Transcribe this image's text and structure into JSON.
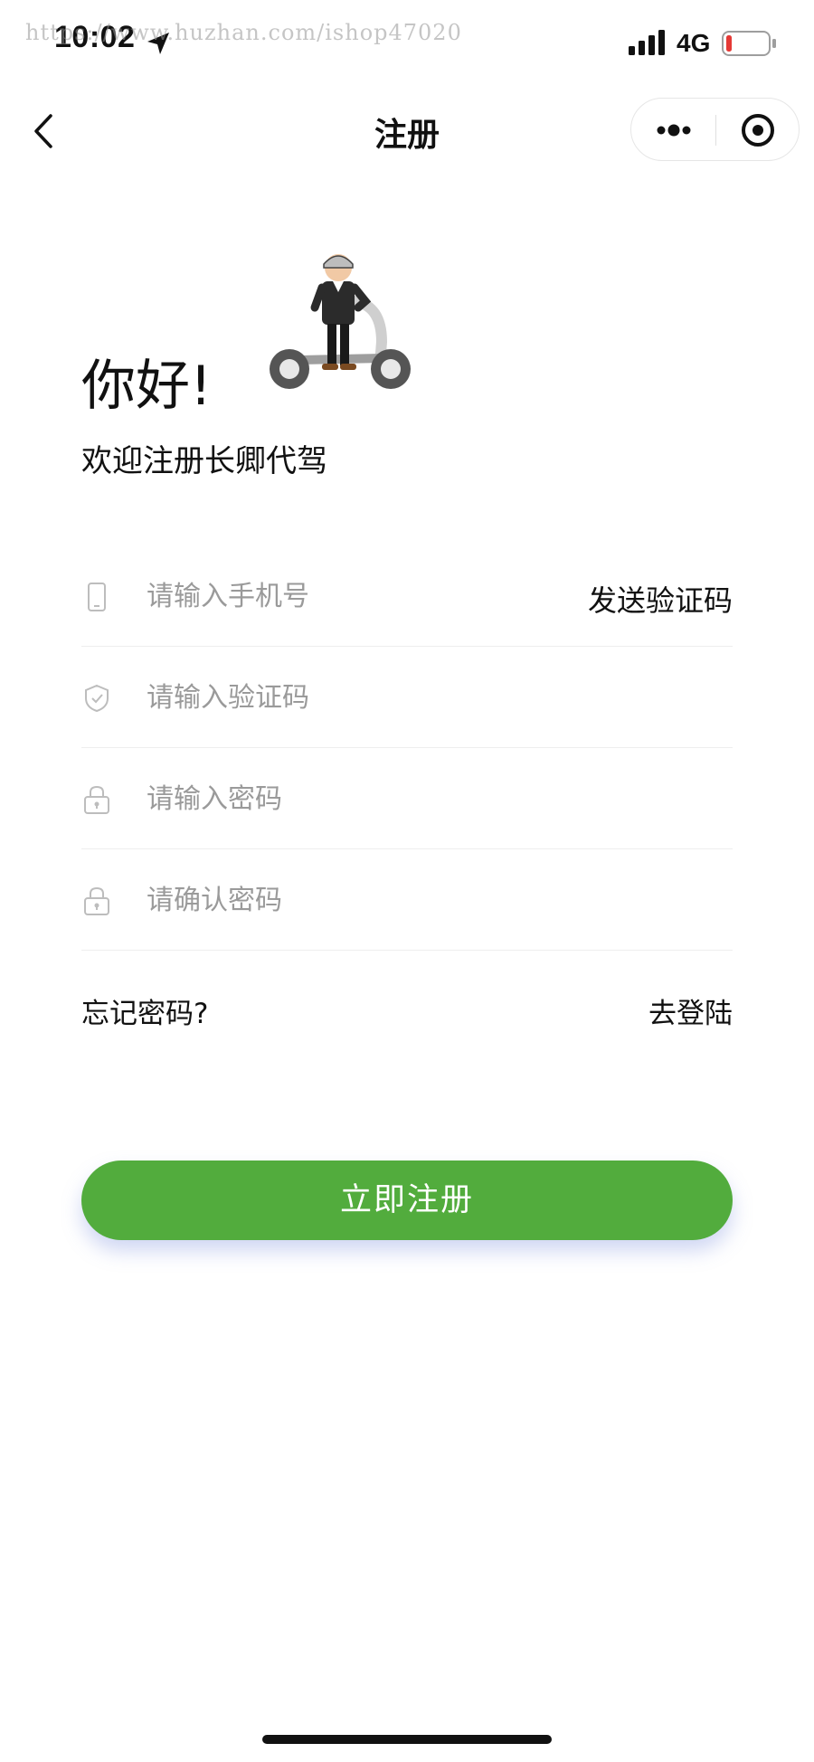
{
  "status_bar": {
    "time": "10:02",
    "network": "4G",
    "watermark": "https://www.huzhan.com/ishop47020",
    "battery_color": "#e53935"
  },
  "nav": {
    "title": "注册",
    "back_icon": "chevron-left-icon",
    "more_icon": "more-dots-icon",
    "close_icon": "target-circle-icon"
  },
  "hero": {
    "greeting": "你好!",
    "welcome": "欢迎注册长卿代驾",
    "mascot": "driver-on-scooter"
  },
  "form": {
    "phone": {
      "placeholder": "请输入手机号",
      "icon": "phone-icon",
      "value": ""
    },
    "send_code": "发送验证码",
    "code": {
      "placeholder": "请输入验证码",
      "icon": "shield-icon",
      "value": ""
    },
    "password": {
      "placeholder": "请输入密码",
      "icon": "lock-icon",
      "value": ""
    },
    "confirm_password": {
      "placeholder": "请确认密码",
      "icon": "lock-icon",
      "value": ""
    }
  },
  "links": {
    "forgot": "忘记密码?",
    "login": "去登陆"
  },
  "actions": {
    "register": "立即注册",
    "accent_color": "#52ac3d"
  }
}
